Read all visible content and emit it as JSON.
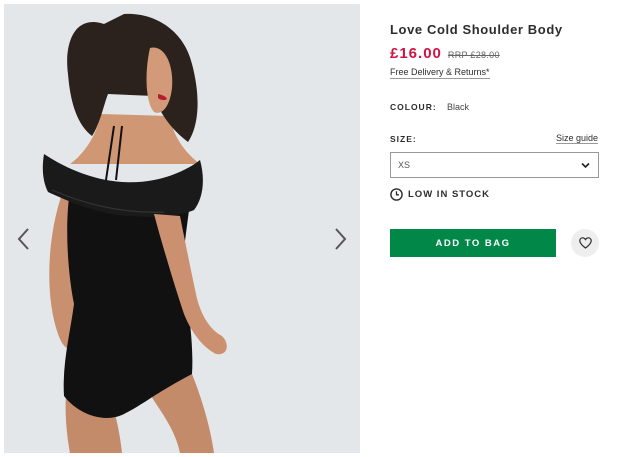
{
  "gallery": {
    "image_alt": "Model wearing Love Cold Shoulder Body",
    "prev_icon": "chevron-left-icon",
    "next_icon": "chevron-right-icon"
  },
  "product": {
    "title": "Love Cold Shoulder Body",
    "price": "£16.00",
    "rrp": "RRP £28.00",
    "delivery_link": "Free Delivery & Returns*"
  },
  "colour": {
    "label": "COLOUR:",
    "value": "Black"
  },
  "size": {
    "label": "SIZE:",
    "guide_link": "Size guide",
    "selected": "XS"
  },
  "stock": {
    "icon": "clock-icon",
    "text": "LOW IN STOCK"
  },
  "actions": {
    "add_to_bag": "ADD TO BAG",
    "save_icon": "heart-icon"
  },
  "colors": {
    "price": "#d01345",
    "add_to_bag": "#018849",
    "image_background": "#e3e7ea"
  }
}
